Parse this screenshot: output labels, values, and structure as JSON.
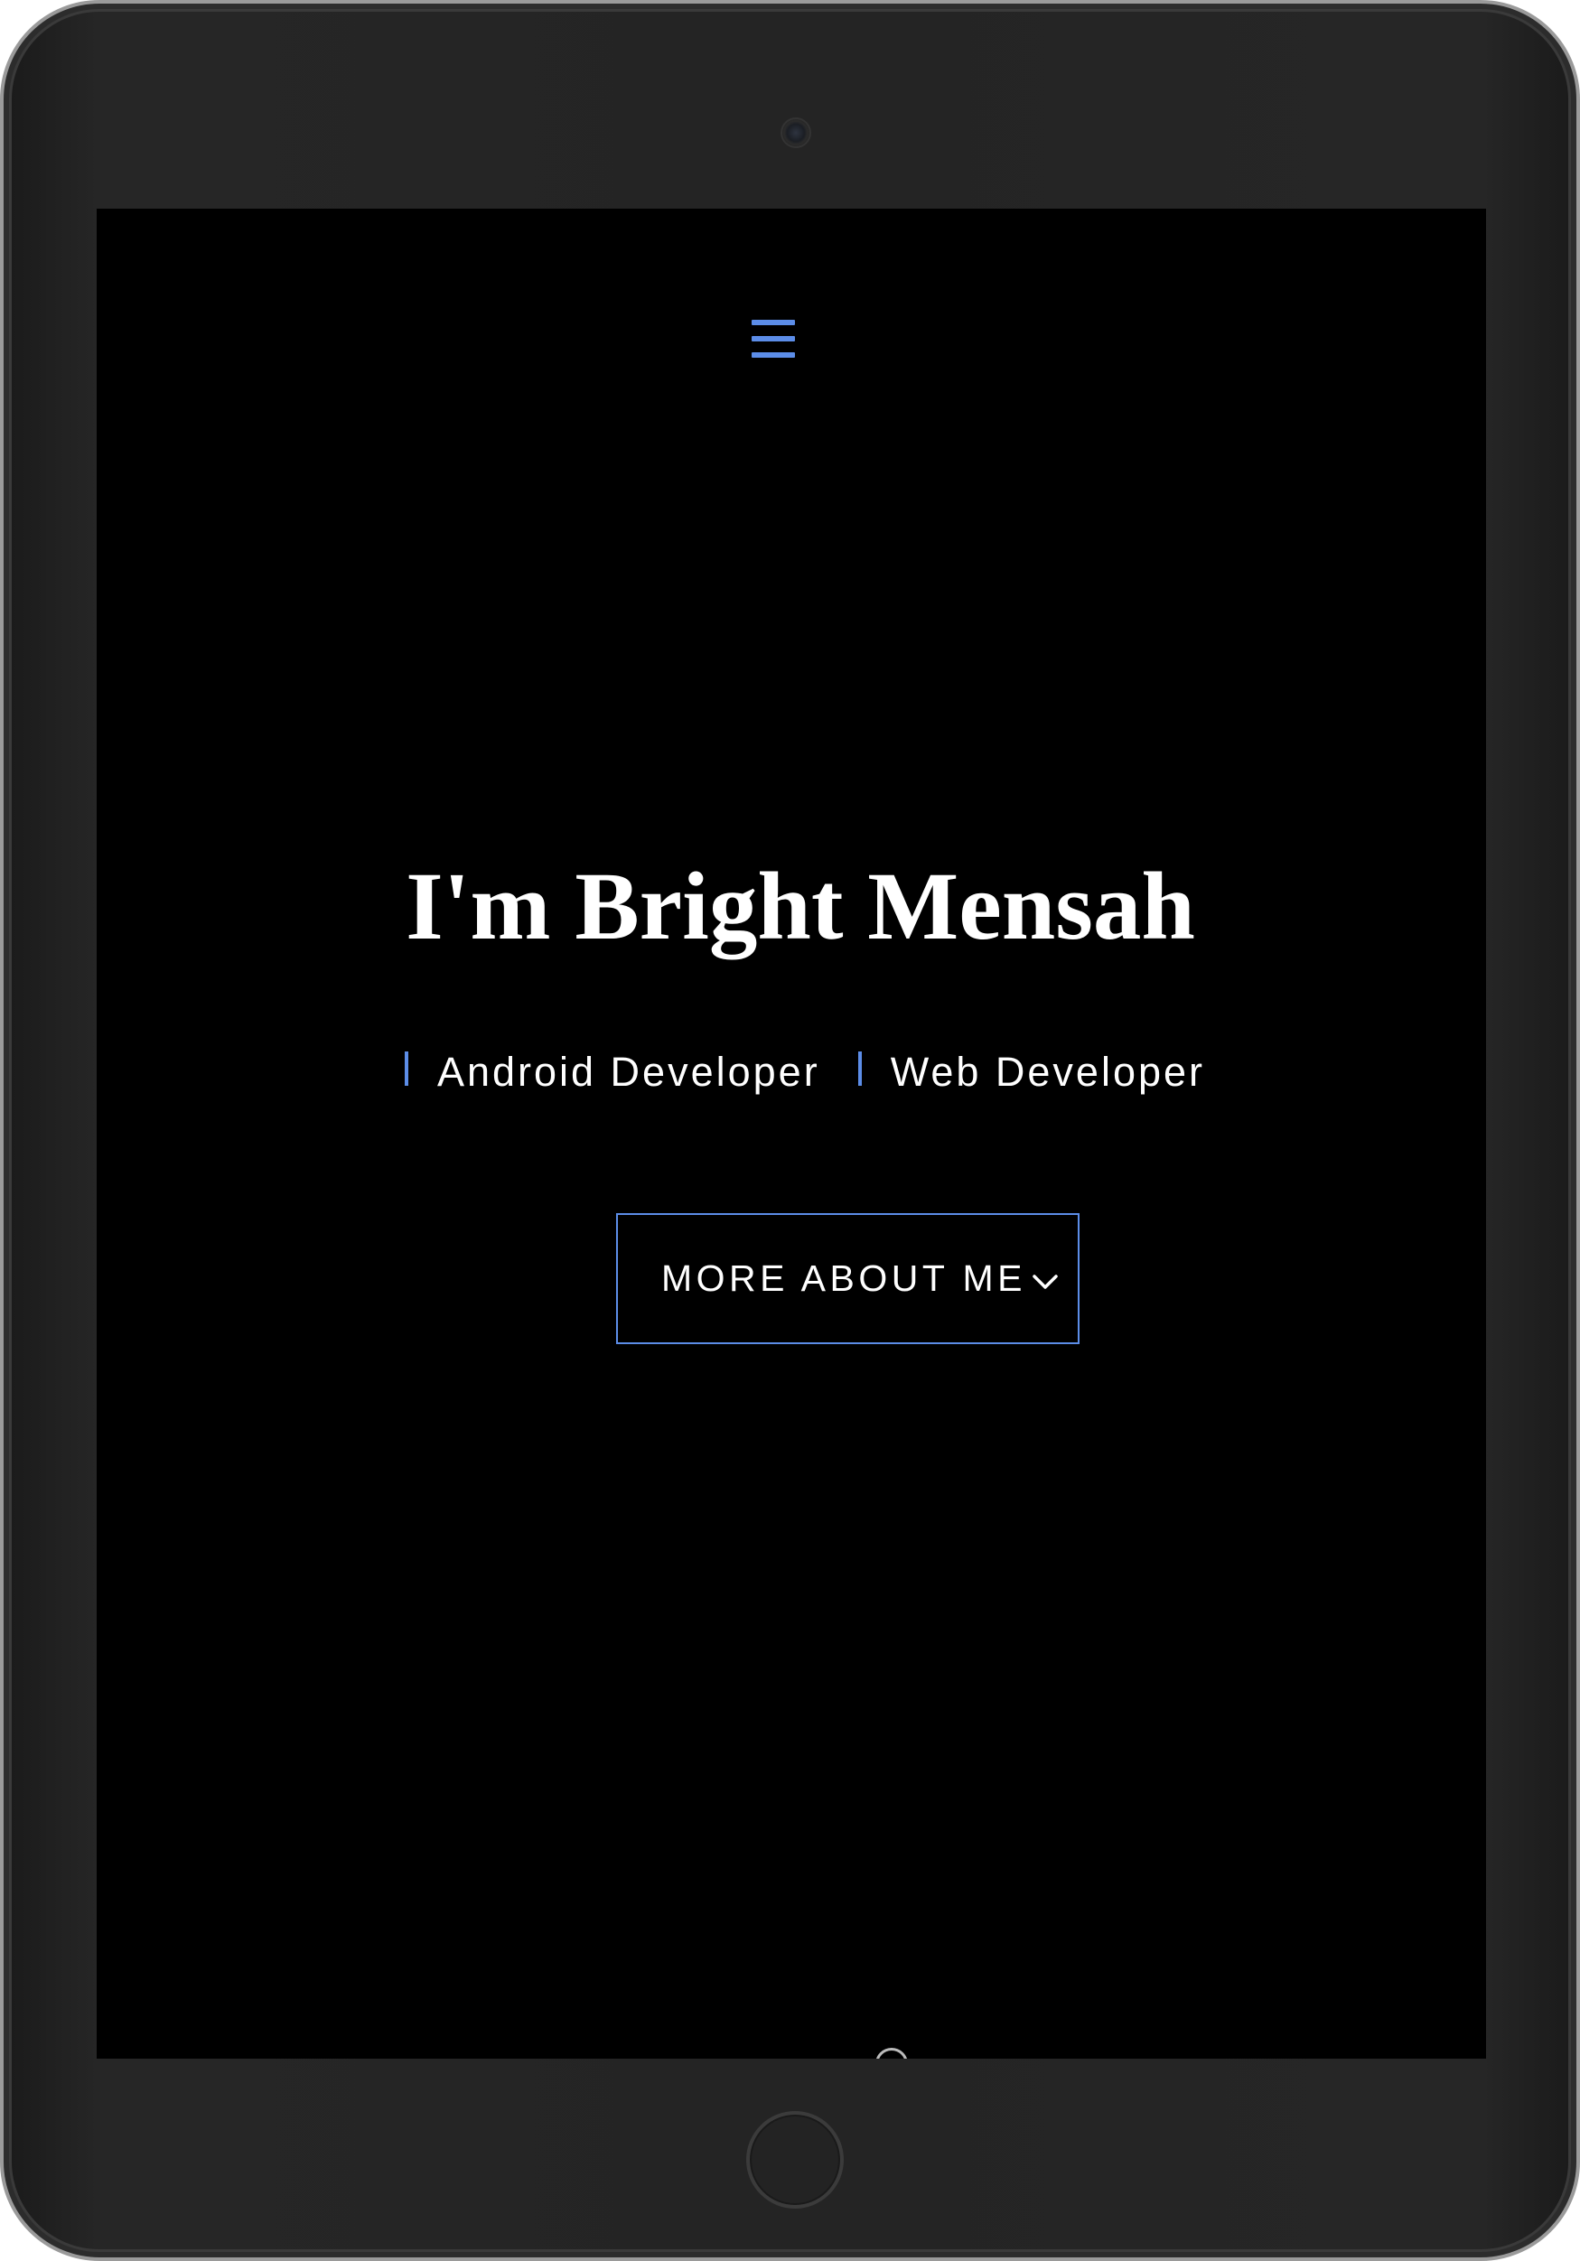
{
  "header": {
    "menu_icon": "hamburger-menu-icon",
    "menu_color": "#5c8de8"
  },
  "hero": {
    "title": "I'm Bright Mensah",
    "roles": [
      {
        "label": "Android Developer"
      },
      {
        "label": "Web Developer"
      }
    ],
    "cta_label": "MORE ABOUT ME",
    "cta_icon": "chevron-down-icon",
    "accent_color": "#5c8de8",
    "background_color": "#000000",
    "text_color": "#ffffff"
  },
  "device": {
    "type": "tablet",
    "frame_color": "#242424"
  }
}
